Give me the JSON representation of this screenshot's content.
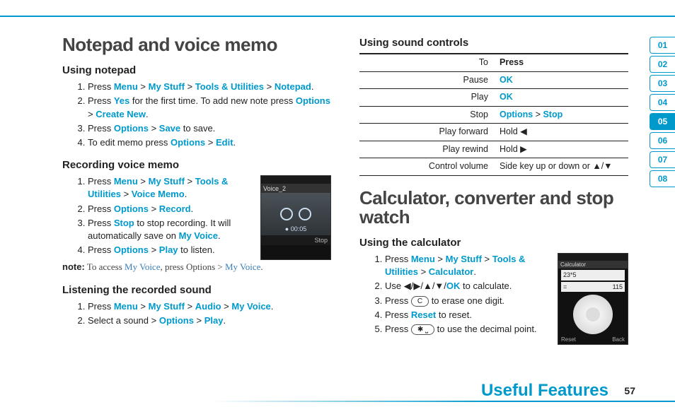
{
  "left": {
    "h1": "Notepad and voice memo",
    "s1": {
      "title": "Using notepad",
      "i1a": "Press ",
      "i1b": "Menu",
      "i1c": "My Stuff",
      "i1d": "Tools & Utilities",
      "i1e": "Notepad",
      "i1f": ".",
      "i2a": "Press ",
      "i2b": "Yes",
      "i2c": " for the first time. To add new note press ",
      "i2d": "Options",
      "i2e": "Create New",
      "i2f": ".",
      "i3a": "Press ",
      "i3b": "Options",
      "i3c": "Save",
      "i3d": " to save.",
      "i4a": "To edit memo press ",
      "i4b": "Options",
      "i4c": "Edit",
      "i4d": "."
    },
    "s2": {
      "title": "Recording voice memo",
      "shot": {
        "title": "Voice_2",
        "time": "● 00:05",
        "stop": "Stop"
      },
      "i1a": "Press ",
      "i1b": "Menu",
      "i1c": "My Stuff",
      "i1d": "Tools & Utilities",
      "i1e": "Voice Memo",
      "i1f": ".",
      "i2a": "Press ",
      "i2b": "Options",
      "i2c": "Record",
      "i2d": ".",
      "i3a": "Press ",
      "i3b": "Stop",
      "i3c": " to stop recording. It will automatically save on ",
      "i3d": "My Voice",
      "i3e": ".",
      "i4a": "Press ",
      "i4b": "Options",
      "i4c": "Play",
      "i4d": " to listen."
    },
    "note": {
      "label": "note:",
      "a": " To access ",
      "b": "My Voice",
      "c": ", press ",
      "d": "Options",
      "e": " > ",
      "f": "My Voice",
      "g": "."
    },
    "s3": {
      "title": "Listening the recorded sound",
      "i1a": "Press ",
      "i1b": "Menu",
      "i1c": "My Stuff",
      "i1d": "Audio",
      "i1e": "My Voice",
      "i1f": ".",
      "i2a": "Select a sound > ",
      "i2b": "Options",
      "i2c": "Play",
      "i2d": "."
    }
  },
  "right": {
    "sc": {
      "title": "Using sound controls",
      "head_to": "To",
      "head_press": "Press",
      "r1a": "Pause",
      "r1b": "OK",
      "r2a": "Play",
      "r2b": "OK",
      "r3a": "Stop",
      "r3b1": "Options",
      "r3b2": "Stop",
      "r4a": "Play forward",
      "r4b": "Hold ◀",
      "r5a": "Play rewind",
      "r5b": "Hold ▶",
      "r6a": "Control volume",
      "r6b": "Side key up or down or ▲/▼"
    },
    "h1": "Calculator, converter and stop watch",
    "calc": {
      "title": "Using the calculator",
      "shot": {
        "title": "Calculator",
        "line1": "23*5",
        "line2": "=",
        "line2r": "115",
        "l": "Reset",
        "r": "Back"
      },
      "i1a": "Press ",
      "i1b": "Menu",
      "i1c": "My Stuff",
      "i1d": "Tools & Utilities",
      "i1e": "Calculator",
      "i1f": ".",
      "i2a": "Use ◀/▶/▲/▼/",
      "i2b": "OK",
      "i2c": " to calculate.",
      "i3a": "Press ",
      "i3key": "C",
      "i3b": " to erase one digit.",
      "i4a": "Press ",
      "i4b": "Reset",
      "i4c": " to reset.",
      "i5a": "Press ",
      "i5key": "✱ ⎵",
      "i5b": " to use the decimal point."
    }
  },
  "tabs": [
    "01",
    "02",
    "03",
    "04",
    "05",
    "06",
    "07",
    "08"
  ],
  "active_tab": "05",
  "footer": {
    "title": "Useful Features",
    "page": "57"
  }
}
